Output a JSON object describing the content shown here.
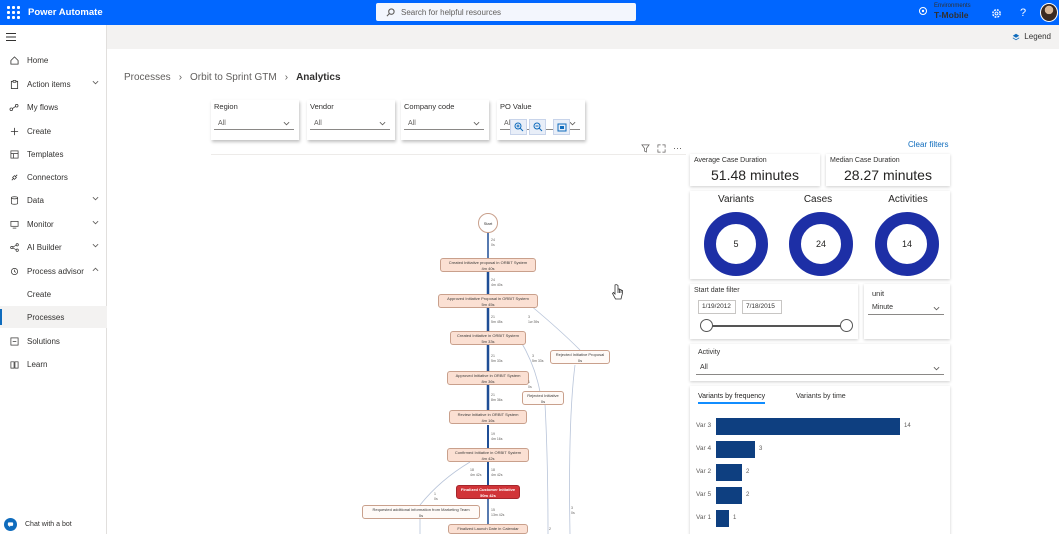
{
  "app": {
    "name": "Power Automate"
  },
  "search": {
    "placeholder": "Search for helpful resources"
  },
  "environment": {
    "label": "Environments",
    "name": "T-Mobile"
  },
  "sidebar": {
    "items": [
      {
        "label": "Home",
        "icon": "home-icon"
      },
      {
        "label": "Action items",
        "icon": "clipboard-icon",
        "expandable": true
      },
      {
        "label": "My flows",
        "icon": "flow-icon"
      },
      {
        "label": "Create",
        "icon": "plus-icon"
      },
      {
        "label": "Templates",
        "icon": "templates-icon"
      },
      {
        "label": "Connectors",
        "icon": "connector-icon"
      },
      {
        "label": "Data",
        "icon": "database-icon",
        "expandable": true
      },
      {
        "label": "Monitor",
        "icon": "monitor-icon",
        "expandable": true
      },
      {
        "label": "AI Builder",
        "icon": "ai-icon",
        "expandable": true
      },
      {
        "label": "Process advisor",
        "icon": "process-icon",
        "expanded": true
      },
      {
        "label": "Create",
        "sub": true
      },
      {
        "label": "Processes",
        "sub": true,
        "active": true
      },
      {
        "label": "Solutions",
        "icon": "solutions-icon"
      },
      {
        "label": "Learn",
        "icon": "book-icon"
      }
    ],
    "chat": "Chat with a bot"
  },
  "cmdbar": {
    "legend": "Legend"
  },
  "breadcrumb": {
    "items": [
      "Processes",
      "Orbit to Sprint GTM",
      "Analytics"
    ]
  },
  "filters": [
    {
      "label": "Region",
      "value": "All"
    },
    {
      "label": "Vendor",
      "value": "All"
    },
    {
      "label": "Company code",
      "value": "All"
    },
    {
      "label": "PO Value",
      "value": "All"
    }
  ],
  "clear_filters": "Clear filters",
  "map": {
    "start": "Start",
    "nodes": [
      {
        "label": "Created Initiative proposal in ORBIT System",
        "time": "4m 40s"
      },
      {
        "label": "Approved Initiative Proposal in ORBIT System",
        "time": "5m 45s"
      },
      {
        "label": "Created Initiative in ORBIT System",
        "time": "5m 33s"
      },
      {
        "label": "Approved Initiative in ORBIT System",
        "time": "8m 36s"
      },
      {
        "label": "Review Initiative in ORBIT System",
        "time": "4m 16s"
      },
      {
        "label": "Confirmed Initiative in ORBIT System",
        "time": "4m 42s"
      },
      {
        "label": "Finalized Customer Initiative",
        "time": "50m 42s"
      },
      {
        "label": "Rejected Initiative Proposal",
        "time": "0s"
      },
      {
        "label": "Rejected Initiative",
        "time": "0s"
      },
      {
        "label": "Requested additional information from Marketing Team",
        "time": "0s"
      },
      {
        "label": "Finalized Launch Date in Calendar",
        "time": ""
      }
    ],
    "edges": [
      {
        "a": "24",
        "b": "0s"
      },
      {
        "a": "24",
        "b": "4m 40s"
      },
      {
        "a": "21",
        "b": "5m 45s"
      },
      {
        "a": "3",
        "b": "1w 39s"
      },
      {
        "a": "21",
        "b": "5m 33s"
      },
      {
        "a": "3",
        "b": "5m 33s"
      },
      {
        "a": "21",
        "b": "8m 36s"
      },
      {
        "a": "1",
        "b": "0s"
      },
      {
        "a": "19",
        "b": "4m 16s"
      },
      {
        "a": "18",
        "b": "4m 42s"
      },
      {
        "a": "18",
        "b": "4m 42s"
      },
      {
        "a": "15",
        "b": "13m 42s"
      },
      {
        "a": "1",
        "b": "0s"
      },
      {
        "a": "2",
        "b": ""
      },
      {
        "a": "3",
        "b": "0s"
      }
    ]
  },
  "kpis": [
    {
      "label": "Average Case Duration",
      "value": "51.48 minutes"
    },
    {
      "label": "Median Case Duration",
      "value": "28.27 minutes"
    }
  ],
  "donuts": [
    {
      "label": "Variants",
      "value": "5"
    },
    {
      "label": "Cases",
      "value": "24"
    },
    {
      "label": "Activities",
      "value": "14"
    }
  ],
  "date_filter": {
    "label": "Start date filter",
    "start": "1/19/2012",
    "end": "7/18/2015"
  },
  "unit": {
    "label": "unit",
    "value": "Minute"
  },
  "activity": {
    "label": "Activity",
    "value": "All"
  },
  "variants_tabs": [
    "Variants by frequency",
    "Variants by time"
  ],
  "colors": {
    "brand": "#0066ff",
    "bar": "#0e3f80",
    "donut": "#1d2fa6"
  },
  "chart_data": {
    "type": "bar",
    "orientation": "horizontal",
    "categories": [
      "Var 3",
      "Var 4",
      "Var 2",
      "Var 5",
      "Var 1"
    ],
    "values": [
      14,
      3,
      2,
      2,
      1
    ],
    "xlim": [
      0,
      14
    ]
  }
}
